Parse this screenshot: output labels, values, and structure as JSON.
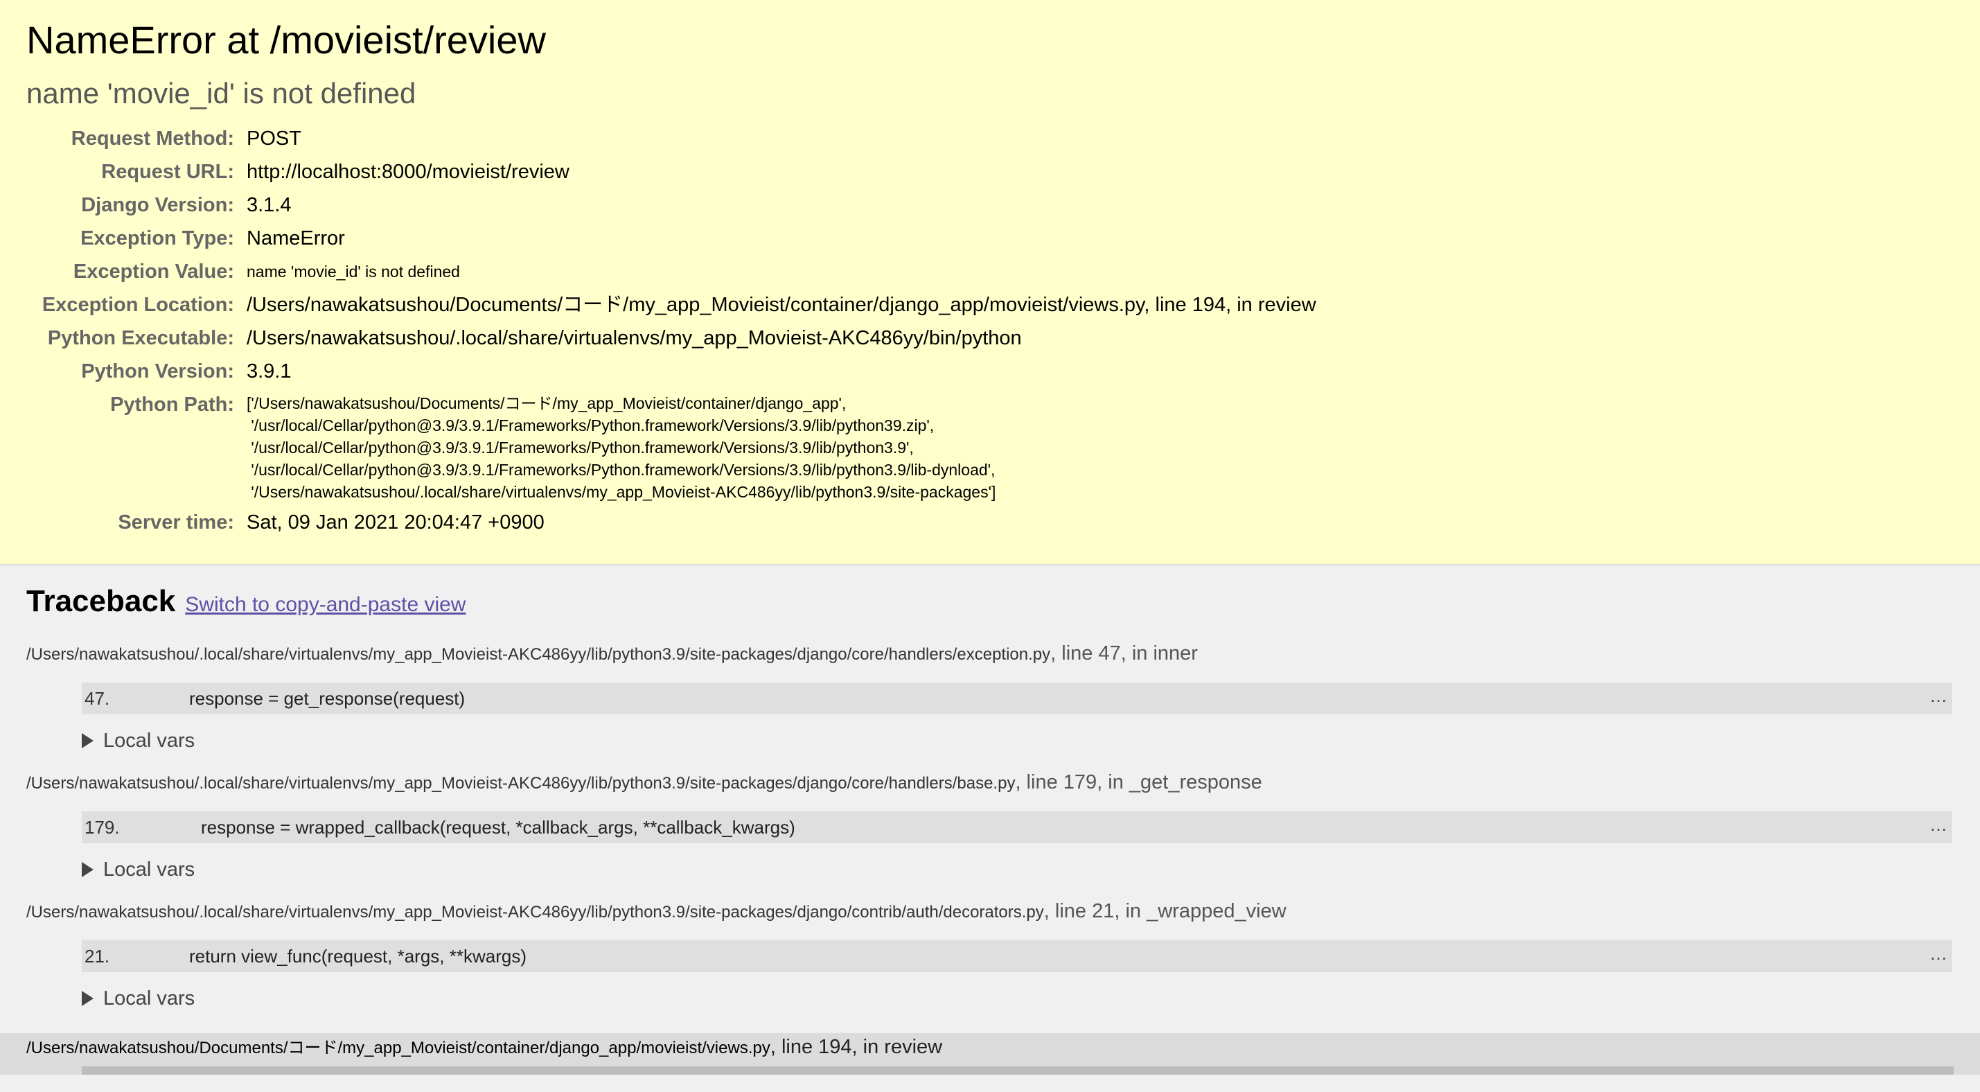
{
  "summary": {
    "title": "NameError at /movieist/review",
    "message": "name 'movie_id' is not defined",
    "rows": [
      {
        "label": "Request Method:",
        "value": "POST"
      },
      {
        "label": "Request URL:",
        "value": "http://localhost:8000/movieist/review"
      },
      {
        "label": "Django Version:",
        "value": "3.1.4"
      },
      {
        "label": "Exception Type:",
        "value": "NameError"
      },
      {
        "label": "Exception Value:",
        "value": "name 'movie_id' is not defined"
      },
      {
        "label": "Exception Location:",
        "value": "/Users/nawakatsushou/Documents/コード/my_app_Movieist/container/django_app/movieist/views.py, line 194, in review"
      },
      {
        "label": "Python Executable:",
        "value": "/Users/nawakatsushou/.local/share/virtualenvs/my_app_Movieist-AKC486yy/bin/python"
      },
      {
        "label": "Python Version:",
        "value": "3.9.1"
      }
    ],
    "python_path": {
      "label": "Python Path:",
      "lines": [
        "['/Users/nawakatsushou/Documents/コード/my_app_Movieist/container/django_app',",
        " '/usr/local/Cellar/python@3.9/3.9.1/Frameworks/Python.framework/Versions/3.9/lib/python39.zip',",
        " '/usr/local/Cellar/python@3.9/3.9.1/Frameworks/Python.framework/Versions/3.9/lib/python3.9',",
        " '/usr/local/Cellar/python@3.9/3.9.1/Frameworks/Python.framework/Versions/3.9/lib/python3.9/lib-dynload',",
        " '/Users/nawakatsushou/.local/share/virtualenvs/my_app_Movieist-AKC486yy/lib/python3.9/site-packages']"
      ]
    },
    "server_time": {
      "label": "Server time:",
      "value": "Sat, 09 Jan 2021 20:04:47 +0900"
    }
  },
  "traceback": {
    "title": "Traceback",
    "switch_label": "Switch to copy-and-paste view",
    "local_vars_label": "Local vars",
    "more_label": "…",
    "frames": [
      {
        "path": "/Users/nawakatsushou/.local/share/virtualenvs/my_app_Movieist-AKC486yy/lib/python3.9/site-packages/django/core/handlers/exception.py",
        "loc": ", line 47, in inner",
        "lineno": "47.",
        "code": "response = get_response(request)"
      },
      {
        "path": "/Users/nawakatsushou/.local/share/virtualenvs/my_app_Movieist-AKC486yy/lib/python3.9/site-packages/django/core/handlers/base.py",
        "loc": ", line 179, in _get_response",
        "lineno": "179.",
        "code": "response = wrapped_callback(request, *callback_args, **callback_kwargs)"
      },
      {
        "path": "/Users/nawakatsushou/.local/share/virtualenvs/my_app_Movieist-AKC486yy/lib/python3.9/site-packages/django/contrib/auth/decorators.py",
        "loc": ", line 21, in _wrapped_view",
        "lineno": "21.",
        "code": "return view_func(request, *args, **kwargs)"
      }
    ],
    "user_frame": {
      "path": "/Users/nawakatsushou/Documents/コード/my_app_Movieist/container/django_app/movieist/views.py",
      "loc": ", line 194, in review"
    }
  }
}
